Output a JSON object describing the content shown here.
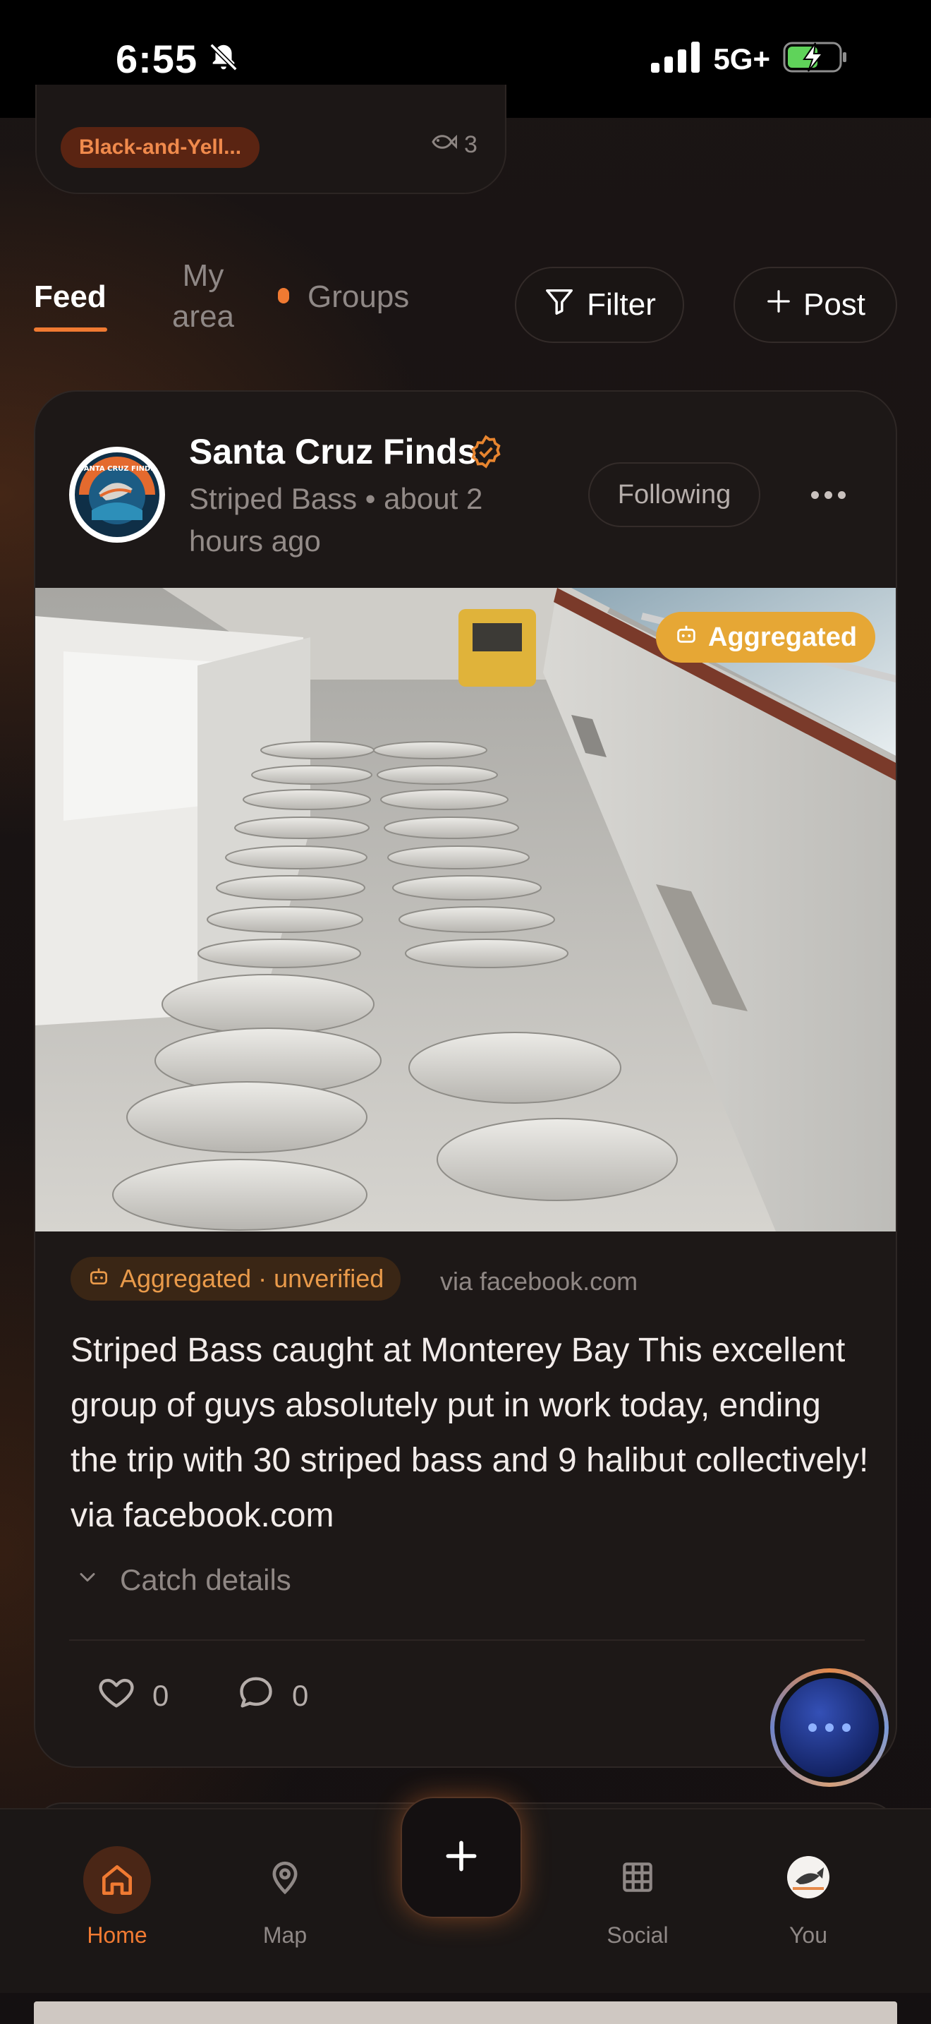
{
  "status_bar": {
    "time": "6:55",
    "network": "5G+"
  },
  "previous_card": {
    "species_chip": "Black-and-Yell...",
    "count": "3"
  },
  "tabs": {
    "feed": "Feed",
    "my_area": "My area",
    "groups": "Groups",
    "filter_label": "Filter",
    "post_label": "Post"
  },
  "post": {
    "author": "Santa Cruz Finds",
    "species": "Striped Bass",
    "time_ago": "about 2 hours ago",
    "following_label": "Following",
    "image_badge": "Aggregated",
    "source_chip": "Aggregated · unverified",
    "source": "via facebook.com",
    "body": "Striped Bass caught at Monterey Bay This excellent group of guys absolutely put in work today, ending the trip with 30 striped bass and 9 halibut collectively! via facebook.com",
    "catch_details_label": "Catch details",
    "likes": "0",
    "comments": "0"
  },
  "nav": {
    "home": "Home",
    "map": "Map",
    "social": "Social",
    "you": "You"
  },
  "colors": {
    "accent": "#f07a32",
    "badge_yellow": "#e6a735",
    "background": "#141011"
  },
  "icons": [
    "bell-slash-icon",
    "signal-icon",
    "battery-charging-icon",
    "fish-icon",
    "filter-icon",
    "plus-icon",
    "verified-icon",
    "more-icon",
    "robot-icon",
    "chevron-down-icon",
    "heart-icon",
    "comment-icon",
    "home-icon",
    "map-pin-icon",
    "grid-icon"
  ]
}
